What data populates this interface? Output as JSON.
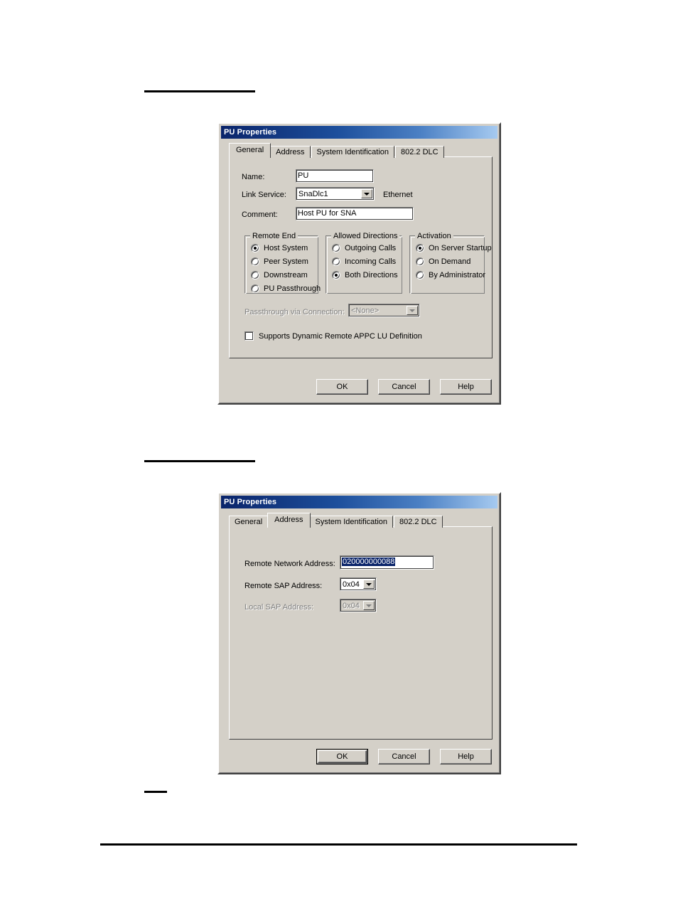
{
  "page": {
    "background": "#ffffff",
    "redactions": [
      "heading-bar-1",
      "heading-bar-2",
      "heading-bar-3",
      "footer-rule"
    ]
  },
  "colors": {
    "titlebar_start": "#0a246a",
    "titlebar_end": "#a6caf0",
    "dialog_face": "#d4d0c8",
    "selection": "#0a246a",
    "disabled_text": "#808080"
  },
  "dialog_general": {
    "title": "PU Properties",
    "tabs": [
      {
        "label": "General",
        "active": true
      },
      {
        "label": "Address",
        "active": false
      },
      {
        "label": "System Identification",
        "active": false
      },
      {
        "label": "802.2 DLC",
        "active": false
      }
    ],
    "fields": {
      "name_label": "Name:",
      "name_value": "PU",
      "link_service_label": "Link Service:",
      "link_service_value": "SnaDlc1",
      "link_service_type": "Ethernet",
      "comment_label": "Comment:",
      "comment_value": "Host PU for SNA"
    },
    "remote_end": {
      "title": "Remote End",
      "options": [
        {
          "label": "Host System",
          "checked": true
        },
        {
          "label": "Peer System",
          "checked": false
        },
        {
          "label": "Downstream",
          "checked": false
        },
        {
          "label": "PU Passthrough",
          "checked": false
        }
      ]
    },
    "allowed_directions": {
      "title": "Allowed Directions",
      "options": [
        {
          "label": "Outgoing Calls",
          "checked": false
        },
        {
          "label": "Incoming Calls",
          "checked": false
        },
        {
          "label": "Both Directions",
          "checked": true
        }
      ]
    },
    "activation": {
      "title": "Activation",
      "options": [
        {
          "label": "On Server Startup",
          "checked": true
        },
        {
          "label": "On Demand",
          "checked": false
        },
        {
          "label": "By Administrator",
          "checked": false
        }
      ]
    },
    "passthrough": {
      "label": "Passthrough via Connection:",
      "value": "<None>",
      "disabled": true
    },
    "dynamic_lu": {
      "label": "Supports Dynamic Remote APPC LU Definition",
      "checked": false
    },
    "buttons": {
      "ok": "OK",
      "cancel": "Cancel",
      "help": "Help"
    }
  },
  "dialog_address": {
    "title": "PU Properties",
    "tabs": [
      {
        "label": "General",
        "active": false
      },
      {
        "label": "Address",
        "active": true
      },
      {
        "label": "System Identification",
        "active": false
      },
      {
        "label": "802.2 DLC",
        "active": false
      }
    ],
    "fields": {
      "remote_network_address_label": "Remote Network Address:",
      "remote_network_address_value": "020000000088",
      "remote_sap_label": "Remote SAP Address:",
      "remote_sap_value": "0x04",
      "local_sap_label": "Local SAP Address:",
      "local_sap_value": "0x04",
      "local_sap_disabled": true
    },
    "buttons": {
      "ok": "OK",
      "cancel": "Cancel",
      "help": "Help"
    }
  }
}
